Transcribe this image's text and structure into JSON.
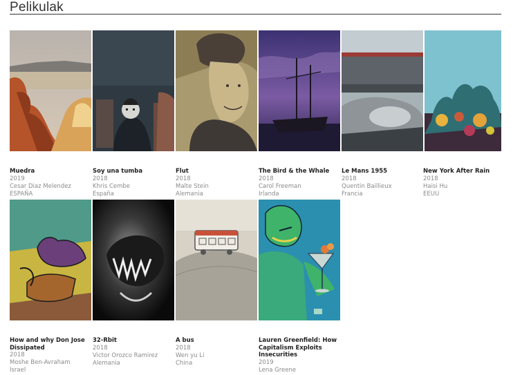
{
  "page": {
    "title": "Pelikulak"
  },
  "films": [
    {
      "title": "Muedra",
      "year": "2019",
      "director": "Cesar Diaz Melendez",
      "country": "ESPAÑA"
    },
    {
      "title": "Soy una tumba",
      "year": "2018",
      "director": "Khris Cembe",
      "country": "España"
    },
    {
      "title": "Flut",
      "year": "2018",
      "director": "Malte Stein",
      "country": "Alemania"
    },
    {
      "title": "The Bird & the Whale",
      "year": "2018",
      "director": "Carol Freeman",
      "country": "Irlanda"
    },
    {
      "title": "Le Mans 1955",
      "year": "2018",
      "director": "Quentin Baillieux",
      "country": "Francia"
    },
    {
      "title": "New York After Rain",
      "year": "2018",
      "director": "Haisi Hu",
      "country": "EEUU"
    },
    {
      "title_lines": [
        "How and why Don Jose",
        "Dissipated"
      ],
      "year": "2018",
      "director": "Moshe Ben-Avraham",
      "country": "Israel"
    },
    {
      "title": "32-Rbit",
      "year": "2018",
      "director": "Victor Orozco Ramirez",
      "country": "Alemania"
    },
    {
      "title": "A bus",
      "year": "2018",
      "director": "Wen yu Li",
      "country": "China"
    },
    {
      "title_lines": [
        "Lauren Greenfield: How",
        "Capitalism Exploits",
        "Insecurities"
      ],
      "year": "2019",
      "director": "Lena Greene",
      "country": ""
    }
  ]
}
